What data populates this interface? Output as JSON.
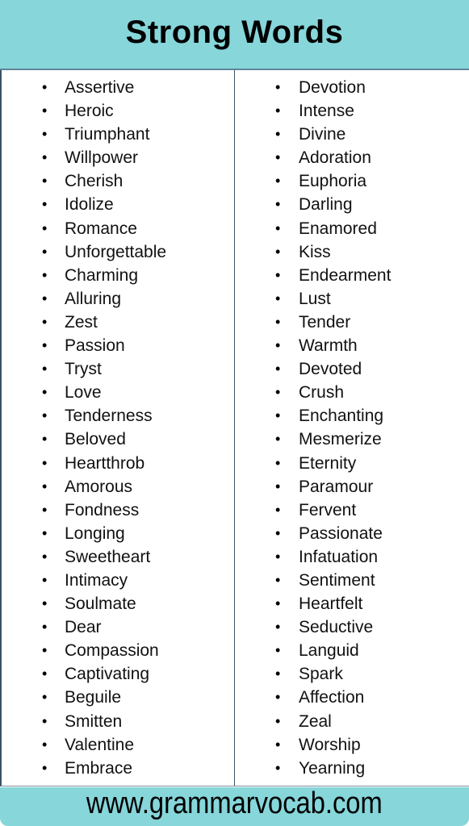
{
  "header": {
    "title": "Strong Words"
  },
  "columns": {
    "left": [
      "Assertive",
      "Heroic",
      "Triumphant",
      "Willpower",
      "Cherish",
      "Idolize",
      "Romance",
      "Unforgettable",
      "Charming",
      "Alluring",
      "Zest",
      "Passion",
      "Tryst",
      "Love",
      "Tenderness",
      "Beloved",
      "Heartthrob",
      "Amorous",
      "Fondness",
      "Longing",
      "Sweetheart",
      "Intimacy",
      "Soulmate",
      "Dear",
      "Compassion",
      "Captivating",
      "Beguile",
      "Smitten",
      "Valentine",
      "Embrace"
    ],
    "right": [
      "Devotion",
      "Intense",
      "Divine",
      "Adoration",
      "Euphoria",
      "Darling",
      "Enamored",
      "Kiss",
      "Endearment",
      "Lust",
      "Tender",
      "Warmth",
      "Devoted",
      "Crush",
      "Enchanting",
      "Mesmerize",
      "Eternity",
      "Paramour",
      "Fervent",
      "Passionate",
      "Infatuation",
      "Sentiment",
      "Heartfelt",
      "Seductive",
      "Languid",
      "Spark",
      "Affection",
      "Zeal",
      "Worship",
      "Yearning"
    ]
  },
  "bullet": "•",
  "footer": {
    "website": "www.grammarvocab.com"
  },
  "colors": {
    "accent": "#86d6da",
    "border": "#3c5366"
  }
}
